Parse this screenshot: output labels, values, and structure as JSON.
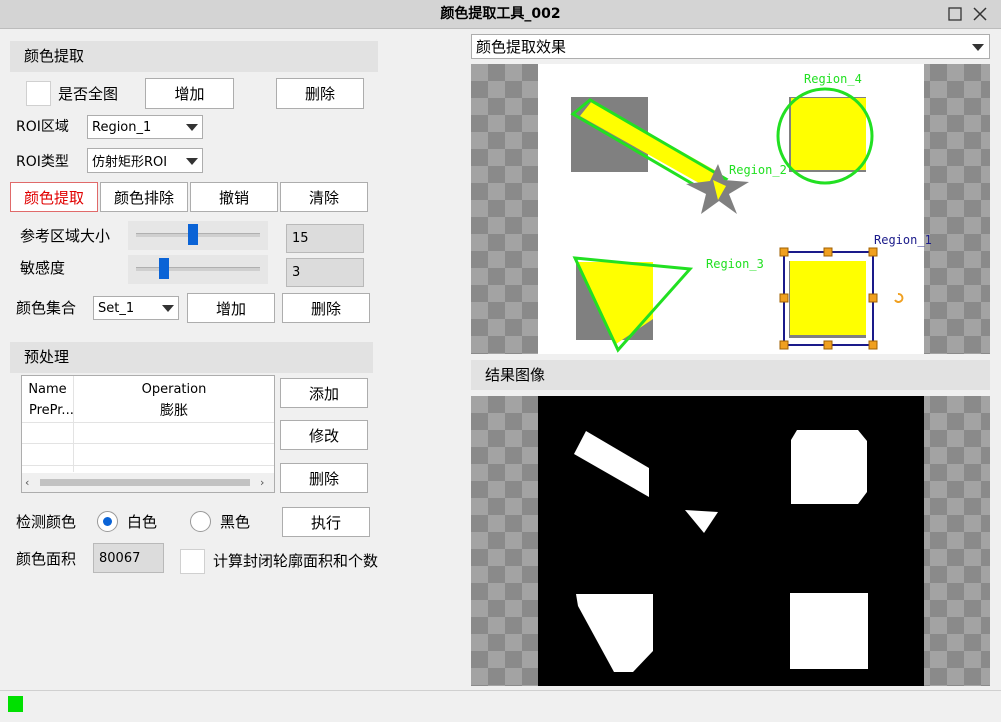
{
  "window": {
    "title": "颜色提取工具_002"
  },
  "color_extract": {
    "section_title": "颜色提取",
    "full_image_label": "是否全图",
    "add_label": "增加",
    "delete_label": "删除",
    "roi_region_label": "ROI区域",
    "roi_region_value": "Region_1",
    "roi_type_label": "ROI类型",
    "roi_type_value": "仿射矩形ROI",
    "tabs": [
      "颜色提取",
      "颜色排除",
      "撤销",
      "清除"
    ],
    "ref_size_label": "参考区域大小",
    "ref_size_value": "15",
    "ref_size_fraction": 0.46,
    "sensitivity_label": "敏感度",
    "sensitivity_value": "3",
    "sensitivity_fraction": 0.2,
    "color_set_label": "颜色集合",
    "color_set_value": "Set_1",
    "color_set_add": "增加",
    "color_set_delete": "删除"
  },
  "preprocess": {
    "section_title": "预处理",
    "columns": [
      "Name",
      "Operation"
    ],
    "rows": [
      {
        "name": "PrePr...",
        "operation": "膨胀"
      }
    ],
    "add_label": "添加",
    "edit_label": "修改",
    "delete_label": "删除"
  },
  "detect": {
    "label": "检测颜色",
    "white_label": "白色",
    "black_label": "黑色",
    "selected": "white",
    "run_label": "执行",
    "area_label": "颜色面积",
    "area_value": "80067",
    "contour_label": "计算封闭轮廓面积和个数"
  },
  "preview": {
    "combo_value": "颜色提取效果",
    "regions": [
      "Region_4",
      "Region_2",
      "Region_3",
      "Region_1"
    ],
    "result_title": "结果图像"
  },
  "colors": {
    "region_green": "#22e022",
    "region_blue": "#1a1a8a",
    "fill_yellow": "#ffff00",
    "status_green": "#00e000"
  }
}
